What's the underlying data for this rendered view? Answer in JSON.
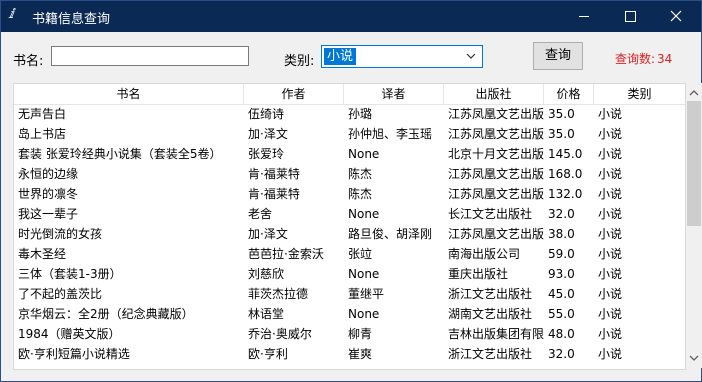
{
  "window": {
    "title": "书籍信息查询"
  },
  "search": {
    "name_label": "书名:",
    "name_value": "",
    "category_label": "类别:",
    "category_value": "小说",
    "query_button": "查询",
    "count_label": "查询数:",
    "count_value": "34"
  },
  "table": {
    "columns": [
      "书名",
      "作者",
      "译者",
      "出版社",
      "价格",
      "类别"
    ],
    "rows": [
      [
        "无声告白",
        "伍绮诗",
        "孙璐",
        "江苏凤凰文艺出版",
        "35.0",
        "小说"
      ],
      [
        "岛上书店",
        "加·泽文",
        "孙仲旭、李玉瑶",
        "江苏凤凰文艺出版",
        "35.0",
        "小说"
      ],
      [
        "套装 张爱玲经典小说集（套装全5卷）",
        "张爱玲",
        "None",
        "北京十月文艺出版",
        "145.0",
        "小说"
      ],
      [
        "永恒的边缘",
        "肯·福莱特",
        "陈杰",
        "江苏凤凰文艺出版",
        "168.0",
        "小说"
      ],
      [
        "世界的凛冬",
        "肯·福莱特",
        "陈杰",
        "江苏凤凰文艺出版",
        "132.0",
        "小说"
      ],
      [
        "我这一辈子",
        "老舍",
        "None",
        "长江文艺出版社",
        "32.0",
        "小说"
      ],
      [
        "时光倒流的女孩",
        "加·泽文",
        "路旦俊、胡泽刚",
        "江苏凤凰文艺出版",
        "38.0",
        "小说"
      ],
      [
        "毒木圣经",
        "芭芭拉·金索沃",
        "张竝",
        "南海出版公司",
        "59.0",
        "小说"
      ],
      [
        "三体（套装1-3册）",
        "刘慈欣",
        "None",
        "重庆出版社",
        "93.0",
        "小说"
      ],
      [
        "了不起的盖茨比",
        "菲茨杰拉德",
        "董继平",
        "浙江文艺出版社",
        "45.0",
        "小说"
      ],
      [
        "京华烟云：全2册（纪念典藏版）",
        "林语堂",
        "None",
        "湖南文艺出版社",
        "55.0",
        "小说"
      ],
      [
        "1984（赠英文版）",
        "乔治·奥威尔",
        "柳青",
        "吉林出版集团有限",
        "48.0",
        "小说"
      ],
      [
        "欧·亨利短篇小说精选",
        "欧·亨利",
        "崔爽",
        "浙江文艺出版社",
        "32.0",
        "小说"
      ]
    ]
  }
}
